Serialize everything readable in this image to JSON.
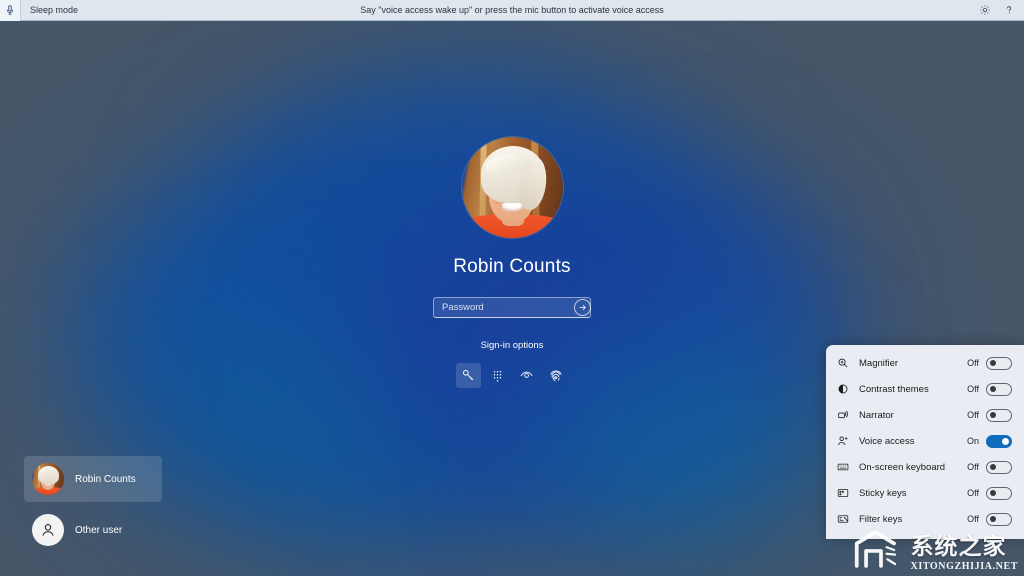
{
  "voice_access_bar": {
    "mic_icon": "microphone-icon",
    "mode_label": "Sleep mode",
    "hint_text": "Say \"voice access wake up\" or press the mic button to activate voice access",
    "settings_icon": "gear-icon",
    "help_icon": "help-question-icon"
  },
  "login": {
    "avatar_alt": "user-avatar-photo",
    "username": "Robin Counts",
    "password": {
      "value": "",
      "placeholder": "Password",
      "submit_icon": "arrow-right-icon"
    },
    "signin_options_label": "Sign-in options",
    "methods": [
      {
        "name": "security-key-icon",
        "label": "Security key",
        "selected": true
      },
      {
        "name": "pin-keypad-icon",
        "label": "PIN",
        "selected": false
      },
      {
        "name": "face-iris-icon",
        "label": "Windows Hello face",
        "selected": false
      },
      {
        "name": "fingerprint-icon",
        "label": "Fingerprint",
        "selected": false
      }
    ]
  },
  "user_list": [
    {
      "name": "Robin Counts",
      "avatar": "photo",
      "active": true
    },
    {
      "name": "Other user",
      "avatar": "generic-person-icon",
      "active": false
    }
  ],
  "accessibility_panel": {
    "items": [
      {
        "icon": "magnifier-icon",
        "label": "Magnifier",
        "state": "Off",
        "on": false
      },
      {
        "icon": "contrast-themes-icon",
        "label": "Contrast themes",
        "state": "Off",
        "on": false
      },
      {
        "icon": "narrator-icon",
        "label": "Narrator",
        "state": "Off",
        "on": false
      },
      {
        "icon": "voice-access-icon",
        "label": "Voice access",
        "state": "On",
        "on": true
      },
      {
        "icon": "on-screen-keyboard-icon",
        "label": "On-screen keyboard",
        "state": "Off",
        "on": false
      },
      {
        "icon": "sticky-keys-icon",
        "label": "Sticky keys",
        "state": "Off",
        "on": false
      },
      {
        "icon": "filter-keys-icon",
        "label": "Filter keys",
        "state": "Off",
        "on": false
      }
    ]
  },
  "watermark": {
    "cn_text": "系统之家",
    "en_text": "XITONGZHIJIA.NET"
  },
  "colors": {
    "desktop_slate": "#46576a",
    "glow_blue": "#1552ad",
    "panel_bg": "#e9edf3",
    "toggle_on": "#0f6cbd",
    "bar_bg": "#dfe6ee"
  }
}
